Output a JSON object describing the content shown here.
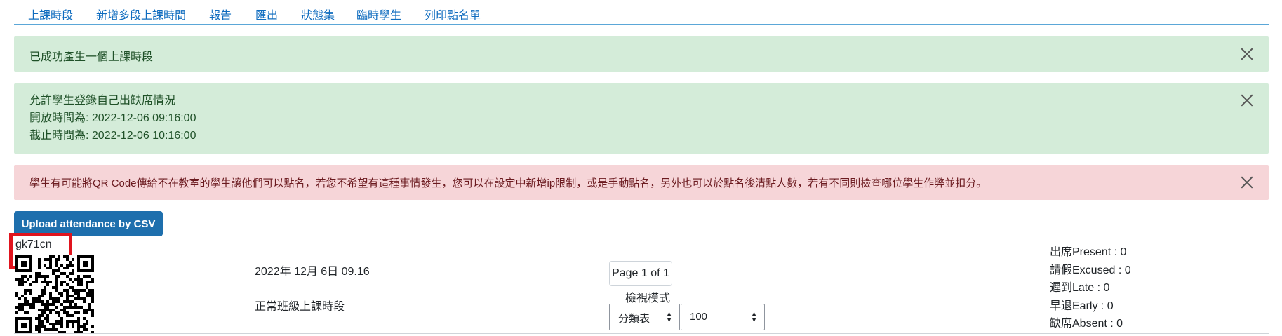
{
  "nav": {
    "items": [
      "上課時段",
      "新增多段上課時間",
      "報告",
      "匯出",
      "狀態集",
      "臨時學生",
      "列印點名單"
    ]
  },
  "alerts": {
    "success1": "已成功產生一個上課時段",
    "success2": {
      "line1": "允許學生登錄自己出缺席情況",
      "line2": "開放時間為: 2022-12-06 09:16:00",
      "line3": "截止時間為: 2022-12-06 10:16:00"
    },
    "danger": "學生有可能將QR Code傳給不在教室的學生讓他們可以點名，若您不希望有這種事情發生，您可以在設定中新增ip限制，或是手動點名，另外也可以於點名後清點人數，若有不同則檢查哪位學生作弊並扣分。"
  },
  "upload_button": "Upload attendance by CSV",
  "session": {
    "code": "gk71cn",
    "date": "2022年 12月 6日 09.16",
    "type": "正常班級上課時段"
  },
  "pager": {
    "label": "Page 1 of 1"
  },
  "view_mode": {
    "label": "檢視模式",
    "select1": "分類表",
    "select2": "100"
  },
  "stats": {
    "present": "出席Present : 0",
    "excused": "請假Excused : 0",
    "late": "遲到Late : 0",
    "early": "早退Early : 0",
    "absent": "缺席Absent : 0"
  },
  "colors": {
    "accent": "#0f6cbf",
    "success_bg": "#d4ecd9",
    "danger_bg": "#f6d5d8",
    "button": "#1e6fad",
    "highlight": "#e0141e"
  }
}
